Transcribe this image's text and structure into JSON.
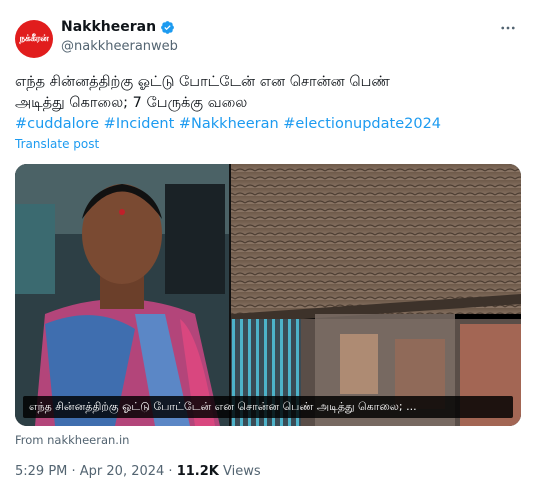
{
  "author": {
    "display_name": "Nakkheeran",
    "handle": "@nakkheeranweb",
    "avatar_text": "நக்கீரன்"
  },
  "tweet": {
    "line1": "எந்த சின்னத்திற்கு ஓட்டு போட்டேன் என சொன்ன பெண்",
    "line2": "அடித்து கொலை; 7 பேருக்கு வலை",
    "hashtags": "#cuddalore #Incident #Nakkheeran #electionupdate2024",
    "translate_label": "Translate post"
  },
  "media": {
    "caption": "எந்த சின்னத்திற்கு ஓட்டு போட்டேன் என சொன்ன பெண் அடித்து கொலை; ..."
  },
  "link_source": "From nakkheeran.in",
  "meta": {
    "time_date": "5:29 PM · Apr 20, 2024 · ",
    "views_count": "11.2K",
    "views_label": " Views"
  },
  "icons": {
    "verified": "verified-badge-icon",
    "more": "more-options-icon"
  },
  "colors": {
    "link_blue": "#1d9bf0",
    "secondary_text": "#536471",
    "avatar_red": "#e11d1d"
  }
}
